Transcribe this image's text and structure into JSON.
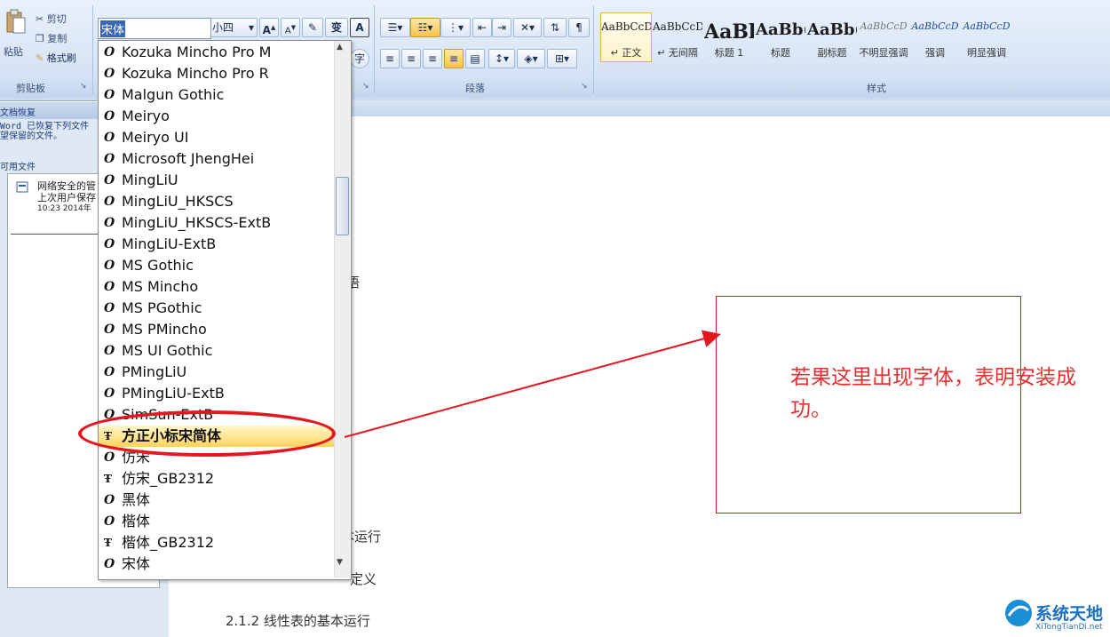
{
  "clipboard": {
    "cut": "剪切",
    "copy": "复制",
    "paste": "粘贴",
    "format_painter": "格式刷",
    "group_label": "剪贴板"
  },
  "font": {
    "current": "宋体",
    "size": "小四"
  },
  "paragraph": {
    "group_label": "段落"
  },
  "styles": {
    "group_label": "样式",
    "items": [
      {
        "sample": "AaBbCcDc",
        "name": "↵ 正文",
        "selected": true
      },
      {
        "sample": "AaBbCcDc",
        "name": "↵ 无间隔"
      },
      {
        "sample": "AaBl",
        "name": "标题 1"
      },
      {
        "sample": "AaBb(",
        "name": "标题"
      },
      {
        "sample": "AaBb(",
        "name": "副标题"
      },
      {
        "sample": "AaBbCcD",
        "name": "不明显强调"
      },
      {
        "sample": "AaBbCcD",
        "name": "强调"
      },
      {
        "sample": "AaBbCcD",
        "name": "明显强调"
      }
    ]
  },
  "recovery": {
    "header": "文档恢复",
    "message_line1": "Word 已恢复下列文件",
    "message_line2": "望保留的文件。",
    "available": "可用文件",
    "file_name": "网络安全的管",
    "file_desc": "上次用户保存",
    "file_time": "10:23 2014年"
  },
  "font_list": [
    {
      "name": "Kozuka Mincho Pro M",
      "type": "O"
    },
    {
      "name": "Kozuka Mincho Pro R",
      "type": "O"
    },
    {
      "name": "Malgun Gothic",
      "type": "O"
    },
    {
      "name": "Meiryo",
      "type": "O"
    },
    {
      "name": "Meiryo UI",
      "type": "O"
    },
    {
      "name": "Microsoft JhengHei",
      "type": "O"
    },
    {
      "name": "MingLiU",
      "type": "O"
    },
    {
      "name": "MingLiU_HKSCS",
      "type": "O"
    },
    {
      "name": "MingLiU_HKSCS-ExtB",
      "type": "O"
    },
    {
      "name": "MingLiU-ExtB",
      "type": "O"
    },
    {
      "name": "MS Gothic",
      "type": "O"
    },
    {
      "name": "MS Mincho",
      "type": "O"
    },
    {
      "name": "MS PGothic",
      "type": "O"
    },
    {
      "name": "MS PMincho",
      "type": "O"
    },
    {
      "name": "MS UI Gothic",
      "type": "O"
    },
    {
      "name": "PMingLiU",
      "type": "O"
    },
    {
      "name": "PMingLiU-ExtB",
      "type": "O"
    },
    {
      "name": "SimSun-ExtB",
      "type": "O"
    },
    {
      "name": "方正小标宋简体",
      "type": "T",
      "highlighted": true
    },
    {
      "name": "仿宋",
      "type": "O"
    },
    {
      "name": "仿宋_GB2312",
      "type": "T"
    },
    {
      "name": "黑体",
      "type": "O"
    },
    {
      "name": "楷体",
      "type": "O"
    },
    {
      "name": "楷体_GB2312",
      "type": "T"
    },
    {
      "name": "宋体",
      "type": "O"
    }
  ],
  "doc": {
    "frag1": "语",
    "frag2": "本运行",
    "frag3": "定义",
    "heading": "2.1.2 线性表的基本运行"
  },
  "annotation": {
    "text": "若果这里出现字体，表明安装成功。",
    "color": "#e63030"
  },
  "watermark": {
    "name": "系统天地",
    "url": "XiTongTianDi.net"
  }
}
